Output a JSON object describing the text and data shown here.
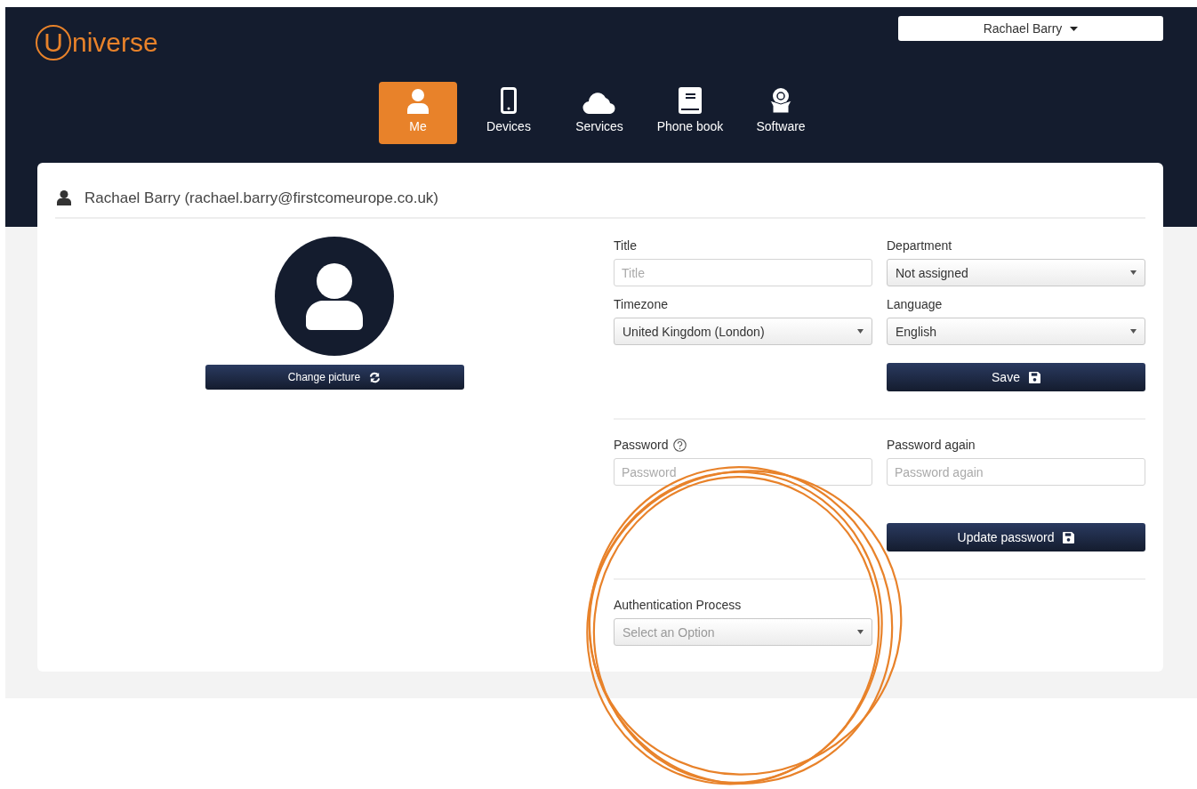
{
  "logo": {
    "letter": "U",
    "rest": "niverse"
  },
  "user_menu": {
    "label": "Rachael Barry"
  },
  "nav": [
    {
      "label": "Me",
      "kind": "person",
      "selected": true
    },
    {
      "label": "Devices",
      "kind": "phone",
      "selected": false
    },
    {
      "label": "Services",
      "kind": "cloud",
      "selected": false
    },
    {
      "label": "Phone book",
      "kind": "book",
      "selected": false
    },
    {
      "label": "Software",
      "kind": "box",
      "selected": false
    }
  ],
  "profile": {
    "heading": "Rachael Barry (rachael.barry@firstcomeurope.co.uk)",
    "change_picture": "Change picture"
  },
  "details": {
    "fields": [
      {
        "label": "Title",
        "kind": "input",
        "placeholder": "Title"
      },
      {
        "label": "Department",
        "kind": "select",
        "value": "Not assigned"
      },
      {
        "label": "Timezone",
        "kind": "select",
        "value": "United Kingdom (London)"
      },
      {
        "label": "Language",
        "kind": "select",
        "value": "English"
      }
    ],
    "save": "Save"
  },
  "password": {
    "fields": [
      {
        "label": "Password",
        "placeholder": "Password",
        "help": true
      },
      {
        "label": "Password again",
        "placeholder": "Password again",
        "help": false
      }
    ],
    "update": "Update password"
  },
  "authentication": {
    "label": "Authentication Process",
    "placeholder": "Select an Option"
  }
}
